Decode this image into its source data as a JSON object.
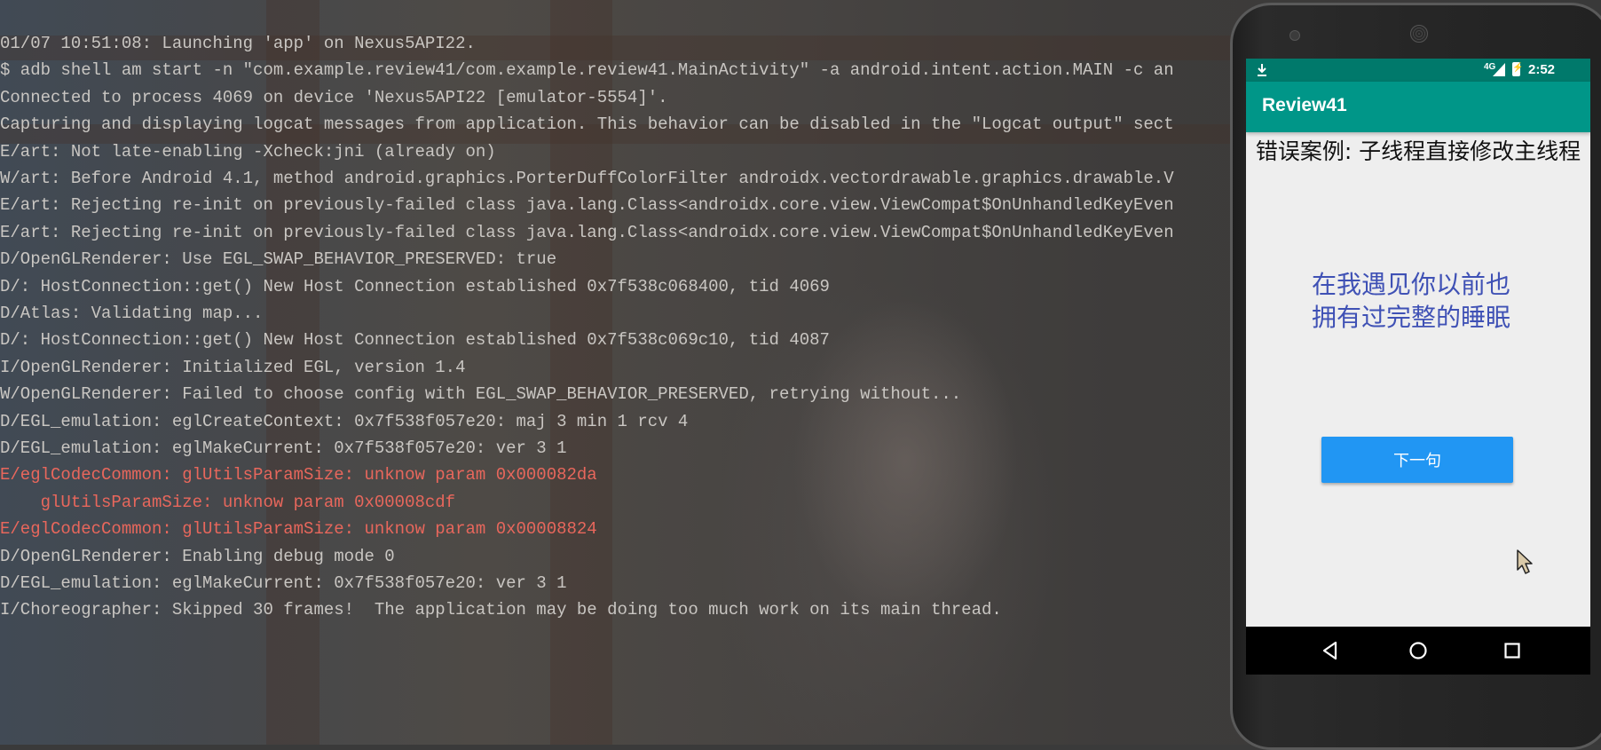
{
  "logcat": {
    "lines": [
      {
        "text": "01/07 10:51:08: Launching 'app' on Nexus5API22.",
        "level": "info"
      },
      {
        "text": "$ adb shell am start -n \"com.example.review41/com.example.review41.MainActivity\" -a android.intent.action.MAIN -c an",
        "level": "info"
      },
      {
        "text": "Connected to process 4069 on device 'Nexus5API22 [emulator-5554]'.",
        "level": "info"
      },
      {
        "text": "Capturing and displaying logcat messages from application. This behavior can be disabled in the \"Logcat output\" sect",
        "level": "info"
      },
      {
        "text": "E/art: Not late-enabling -Xcheck:jni (already on)",
        "level": "info"
      },
      {
        "text": "W/art: Before Android 4.1, method android.graphics.PorterDuffColorFilter androidx.vectordrawable.graphics.drawable.V",
        "level": "info"
      },
      {
        "text": "E/art: Rejecting re-init on previously-failed class java.lang.Class<androidx.core.view.ViewCompat$OnUnhandledKeyEven",
        "level": "info"
      },
      {
        "text": "E/art: Rejecting re-init on previously-failed class java.lang.Class<androidx.core.view.ViewCompat$OnUnhandledKeyEven",
        "level": "info"
      },
      {
        "text": "D/OpenGLRenderer: Use EGL_SWAP_BEHAVIOR_PRESERVED: true",
        "level": "info"
      },
      {
        "text": "D/: HostConnection::get() New Host Connection established 0x7f538c068400, tid 4069",
        "level": "info"
      },
      {
        "text": "D/Atlas: Validating map...",
        "level": "info"
      },
      {
        "text": "D/: HostConnection::get() New Host Connection established 0x7f538c069c10, tid 4087",
        "level": "info"
      },
      {
        "text": "I/OpenGLRenderer: Initialized EGL, version 1.4",
        "level": "info"
      },
      {
        "text": "W/OpenGLRenderer: Failed to choose config with EGL_SWAP_BEHAVIOR_PRESERVED, retrying without...",
        "level": "info"
      },
      {
        "text": "D/EGL_emulation: eglCreateContext: 0x7f538f057e20: maj 3 min 1 rcv 4",
        "level": "info"
      },
      {
        "text": "D/EGL_emulation: eglMakeCurrent: 0x7f538f057e20: ver 3 1",
        "level": "info"
      },
      {
        "text": "E/eglCodecCommon: glUtilsParamSize: unknow param 0x000082da",
        "level": "error"
      },
      {
        "text": "    glUtilsParamSize: unknow param 0x00008cdf",
        "level": "error"
      },
      {
        "text": "E/eglCodecCommon: glUtilsParamSize: unknow param 0x00008824",
        "level": "error"
      },
      {
        "text": "D/OpenGLRenderer: Enabling debug mode 0",
        "level": "info"
      },
      {
        "text": "D/EGL_emulation: eglMakeCurrent: 0x7f538f057e20: ver 3 1",
        "level": "info"
      },
      {
        "text": "I/Choreographer: Skipped 30 frames!  The application may be doing too much work on its main thread.",
        "level": "info"
      }
    ]
  },
  "device": {
    "status_bar": {
      "network_label": "4G",
      "time": "2:52",
      "icons": [
        "download-icon",
        "signal-icon",
        "battery-charging-icon"
      ]
    },
    "app_bar": {
      "title": "Review41"
    },
    "content": {
      "case_title": "错误案例: 子线程直接修改主线程",
      "poem_text": "在我遇见你以前也拥有过完整的睡眠",
      "next_button_label": "下一句"
    },
    "nav_bar": {
      "icons": [
        "back-icon",
        "home-icon",
        "recents-icon"
      ]
    }
  },
  "colors": {
    "status_bar": "#00796b",
    "app_bar": "#009688",
    "poem_text": "#3f51b5",
    "button": "#2196f3",
    "log_error": "#e8675c",
    "log_info": "#c9c6c2"
  }
}
